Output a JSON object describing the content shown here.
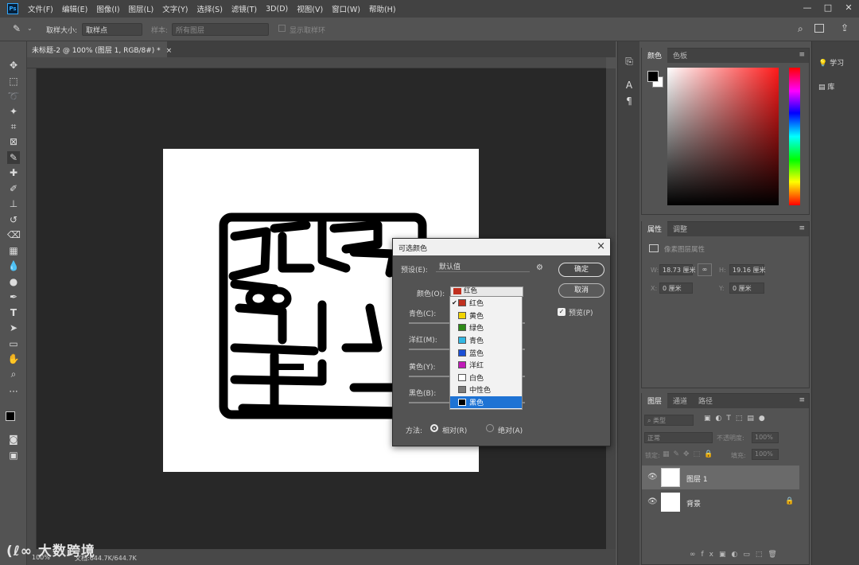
{
  "app": {
    "logo": "Ps"
  },
  "menu": [
    "文件(F)",
    "编辑(E)",
    "图像(I)",
    "图层(L)",
    "文字(Y)",
    "选择(S)",
    "滤镜(T)",
    "3D(D)",
    "视图(V)",
    "窗口(W)",
    "帮助(H)"
  ],
  "window_controls": [
    "—",
    "□",
    "✕"
  ],
  "options": {
    "sample_size_label": "取样大小:",
    "sample_size_value": "取样点",
    "sample_label": "样本:",
    "sample_value": "所有图层",
    "show_ring": "显示取样环"
  },
  "document": {
    "tab_title": "未标题-2 @ 100% (图层 1, RGB/8#) *",
    "zoom": "100%",
    "doc_info": "文档:644.7K/644.7K"
  },
  "color_panel": {
    "tabs": [
      "颜色",
      "色板"
    ]
  },
  "properties_panel": {
    "tabs": [
      "属性",
      "调整"
    ],
    "subtitle": "像素图层属性",
    "w_label": "W:",
    "w_value": "18.73 厘米",
    "h_label": "H:",
    "h_value": "19.16 厘米",
    "x_label": "X:",
    "x_value": "0 厘米",
    "y_label": "Y:",
    "y_value": "0 厘米"
  },
  "layers_panel": {
    "tabs": [
      "图层",
      "通道",
      "路径"
    ],
    "filter_kind": "类型",
    "blend_mode": "正常",
    "opacity_label": "不透明度:",
    "opacity_value": "100%",
    "lock_label": "锁定:",
    "fill_label": "填充:",
    "fill_value": "100%",
    "layers": [
      {
        "name": "图层 1"
      },
      {
        "name": "背景"
      }
    ]
  },
  "far_right": {
    "learn": "学习",
    "library": "库"
  },
  "dialog": {
    "title": "可选颜色",
    "preset_label": "预设(E):",
    "preset_value": "默认值",
    "ok": "确定",
    "cancel": "取消",
    "preview": "预览(P)",
    "colors_label": "颜色(O):",
    "colors_value": "红色",
    "sliders": [
      "青色(C):",
      "洋红(M):",
      "黄色(Y):",
      "黑色(B):"
    ],
    "method_label": "方法:",
    "method_relative": "相对(R)",
    "method_absolute": "绝对(A)",
    "options": [
      {
        "label": "红色",
        "color": "#c0301f"
      },
      {
        "label": "黄色",
        "color": "#f2d400"
      },
      {
        "label": "绿色",
        "color": "#2d8a16"
      },
      {
        "label": "青色",
        "color": "#33b7e3"
      },
      {
        "label": "蓝色",
        "color": "#1a4fd6"
      },
      {
        "label": "洋红",
        "color": "#c01ab8"
      },
      {
        "label": "白色",
        "color": "#ffffff"
      },
      {
        "label": "中性色",
        "color": "#7a7a7a"
      },
      {
        "label": "黑色",
        "color": "#000000"
      }
    ]
  },
  "watermark": "大数跨境"
}
